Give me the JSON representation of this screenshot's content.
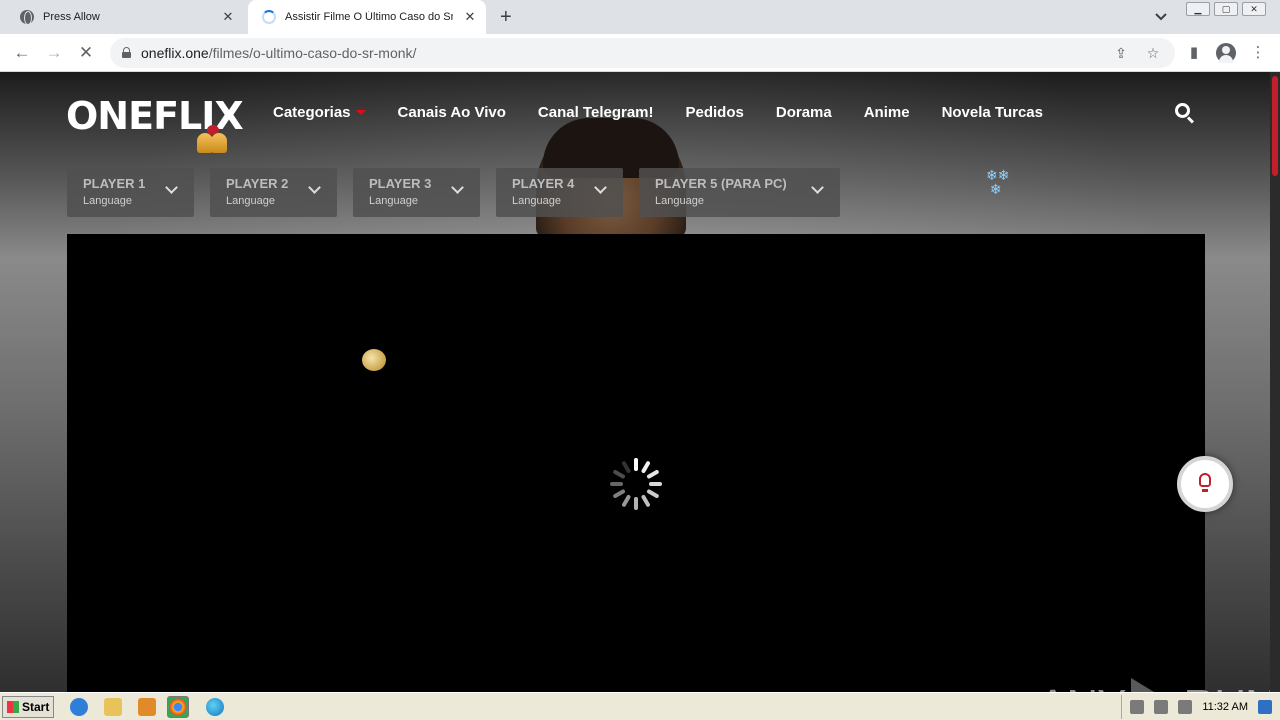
{
  "browser": {
    "tabs": [
      {
        "title": "Press Allow",
        "state": "inactive"
      },
      {
        "title": "Assistir Filme O Último Caso do Sr. M",
        "state": "loading"
      }
    ],
    "window_buttons": [
      "▁",
      "▢",
      "✕"
    ],
    "url_domain": "oneflix.one",
    "url_path": "/filmes/o-ultimo-caso-do-sr-monk/"
  },
  "site": {
    "logo": "ONEFLIX",
    "nav": [
      "Categorias",
      "Canais Ao Vivo",
      "Canal Telegram!",
      "Pedidos",
      "Dorama",
      "Anime",
      "Novela Turcas"
    ],
    "players": [
      {
        "name": "PLAYER 1",
        "sub": "Language"
      },
      {
        "name": "PLAYER 2",
        "sub": "Language"
      },
      {
        "name": "PLAYER 3",
        "sub": "Language"
      },
      {
        "name": "PLAYER 4",
        "sub": "Language"
      },
      {
        "name": "PLAYER 5 (PARA PC)",
        "sub": "Language"
      }
    ],
    "accent_color": "#e50914"
  },
  "watermark": {
    "left": "ANY",
    "right": "RUN"
  },
  "taskbar": {
    "start_label": "Start",
    "clock": "11:32 AM"
  }
}
